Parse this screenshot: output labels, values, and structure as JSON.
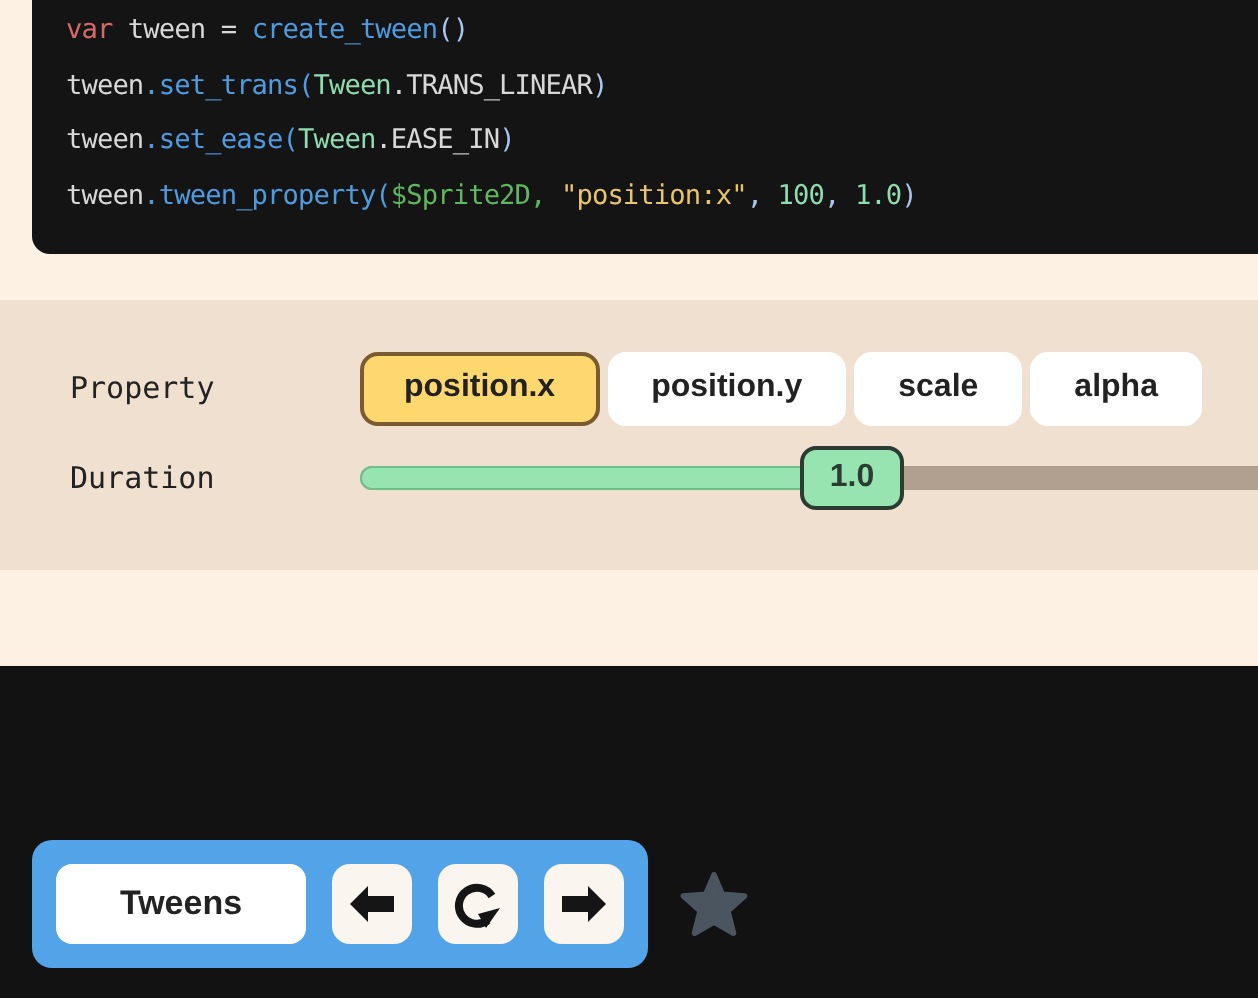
{
  "code": {
    "lines": [
      [
        {
          "text": "var",
          "kind": "keyword"
        },
        {
          "text": " tween = ",
          "kind": "plain"
        },
        {
          "text": "create_tween",
          "kind": "function"
        },
        {
          "text": "()",
          "kind": "punct"
        }
      ],
      [
        {
          "text": "tween",
          "kind": "plain"
        },
        {
          "text": ".set_trans(",
          "kind": "function"
        },
        {
          "text": "Tween",
          "kind": "class"
        },
        {
          "text": ".TRANS_LINEAR",
          "kind": "plain"
        },
        {
          "text": ")",
          "kind": "punct"
        }
      ],
      [
        {
          "text": "tween",
          "kind": "plain"
        },
        {
          "text": ".set_ease(",
          "kind": "function"
        },
        {
          "text": "Tween",
          "kind": "class"
        },
        {
          "text": ".EASE_IN",
          "kind": "plain"
        },
        {
          "text": ")",
          "kind": "punct"
        }
      ],
      [
        {
          "text": "tween",
          "kind": "plain"
        },
        {
          "text": ".tween_property(",
          "kind": "function"
        },
        {
          "text": "$Sprite2D, ",
          "kind": "node"
        },
        {
          "text": "\"position:x\"",
          "kind": "string"
        },
        {
          "text": ", ",
          "kind": "punct"
        },
        {
          "text": "100",
          "kind": "number"
        },
        {
          "text": ", ",
          "kind": "punct"
        },
        {
          "text": "1.0",
          "kind": "number"
        },
        {
          "text": ")",
          "kind": "punct"
        }
      ]
    ]
  },
  "controls": {
    "property": {
      "label": "Property",
      "options": [
        {
          "label": "position.x",
          "selected": true
        },
        {
          "label": "position.y",
          "selected": false
        },
        {
          "label": "scale",
          "selected": false
        },
        {
          "label": "alpha",
          "selected": false
        }
      ]
    },
    "duration": {
      "label": "Duration",
      "level": 0.5,
      "reading": "1.0"
    }
  },
  "toolbar": {
    "title": "Tweens",
    "starred": false
  }
}
